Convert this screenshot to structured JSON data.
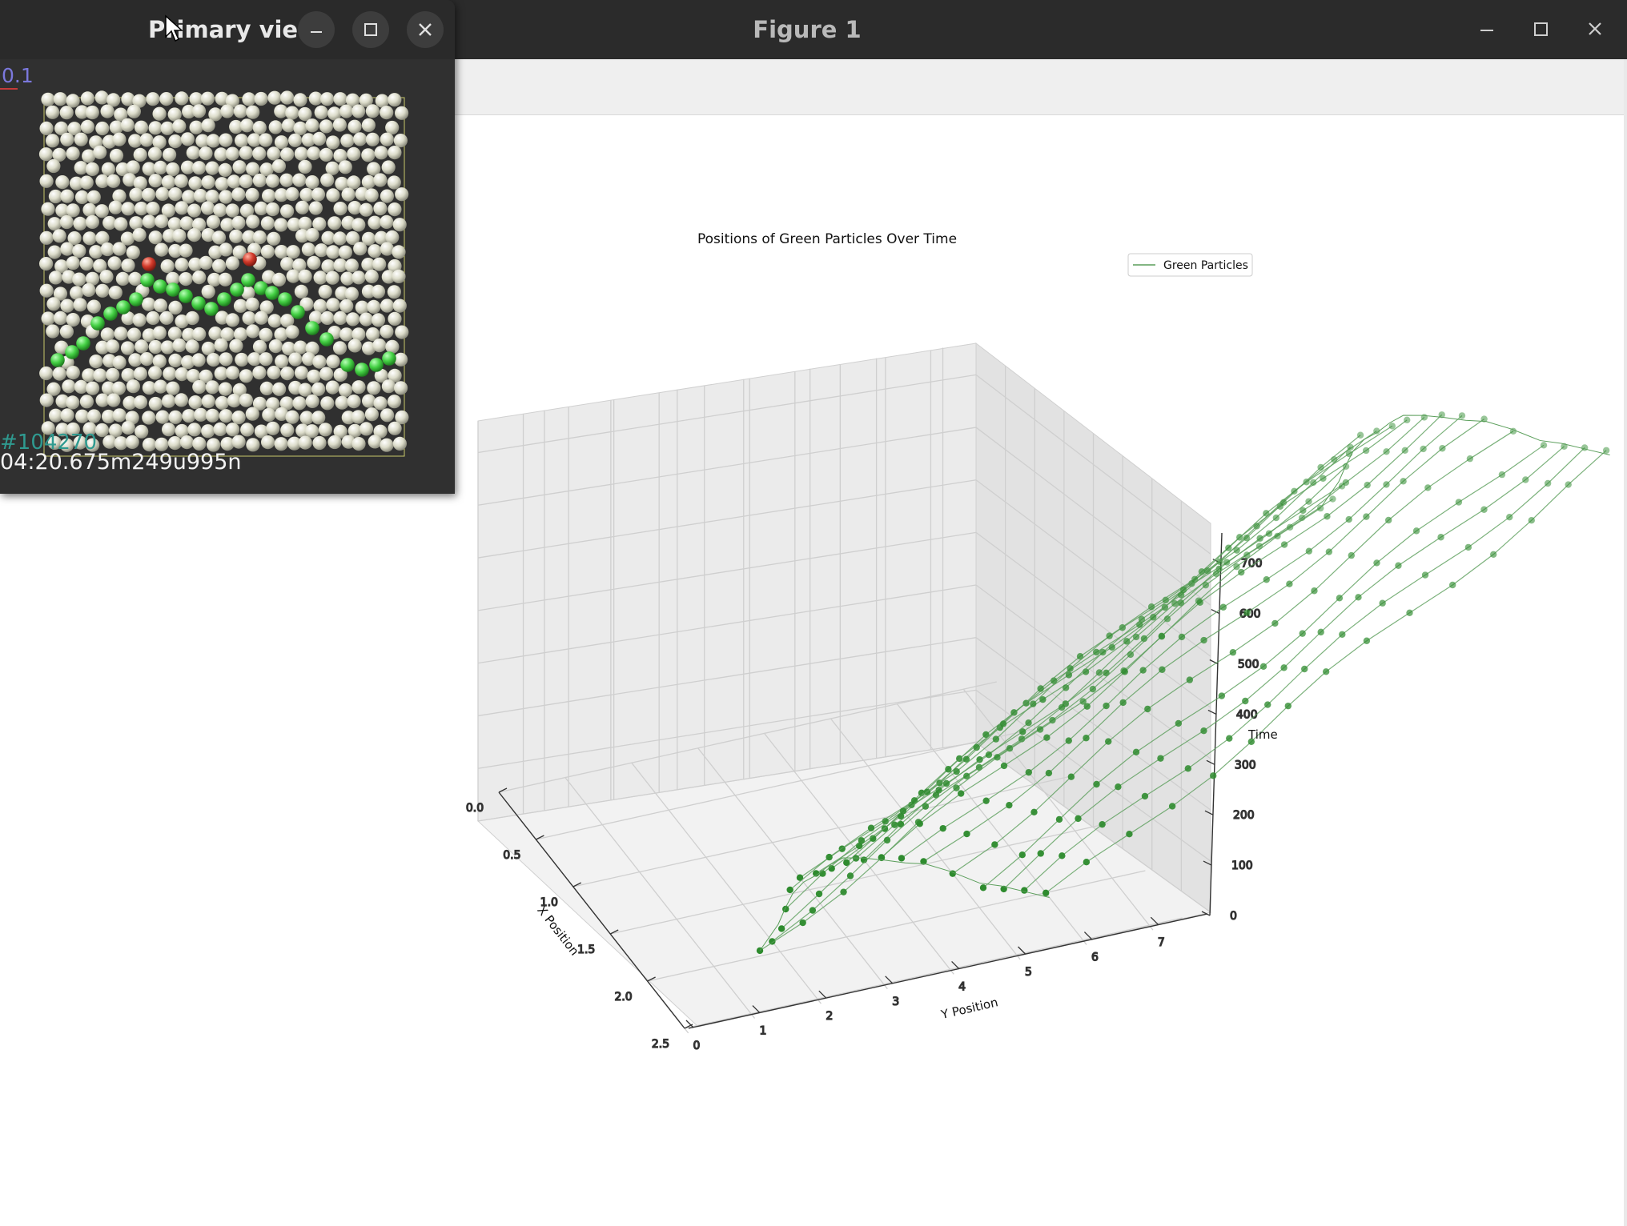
{
  "figure_window": {
    "title": "Figure 1",
    "controls": {
      "minimize": "minimize-icon",
      "maximize": "maximize-icon",
      "close": "close-icon"
    }
  },
  "primary_view": {
    "title": "Primary view",
    "scale_label": "0.1",
    "frame_label": "#104270",
    "time_label": "04:20.675m249u995n",
    "colors": {
      "particle": "#e9e9d2",
      "green": "#44d044",
      "red": "#d23a2a",
      "background": "#303030"
    }
  },
  "chart_data": {
    "type": "3d-line-scatter",
    "title": "Positions of Green Particles Over Time",
    "xlabel": "X Position",
    "ylabel": "Y Position",
    "zlabel": "Time",
    "xlim": [
      0.0,
      2.5
    ],
    "ylim": [
      0,
      7.5
    ],
    "zlim": [
      0,
      760
    ],
    "xticks": [
      "0.0",
      "0.5",
      "1.0",
      "1.5",
      "2.0",
      "2.5"
    ],
    "yticks": [
      "0",
      "1",
      "2",
      "3",
      "4",
      "5",
      "6",
      "7"
    ],
    "zticks": [
      "0",
      "100",
      "200",
      "300",
      "400",
      "500",
      "600",
      "700"
    ],
    "legend": {
      "label": "Green Particles",
      "placement": "upper-right"
    },
    "grid": true,
    "color": "#2e8b2e",
    "series": [
      {
        "name": "Green Particles",
        "y_positions": [
          1.75,
          2.0,
          2.25,
          2.5,
          2.75,
          3.0,
          3.25,
          3.5,
          3.75,
          4.0,
          4.25,
          4.5,
          4.75,
          5.0,
          5.25,
          5.5,
          5.75,
          6.0
        ],
        "time_steps": [
          0,
          50,
          100,
          150,
          200,
          250,
          300,
          350,
          400,
          450,
          500,
          550,
          600,
          650,
          700
        ],
        "x_profile": [
          1.95,
          1.85,
          1.75,
          1.62,
          1.5,
          1.42,
          1.38,
          1.32,
          1.28,
          1.32,
          1.38,
          1.45,
          1.5,
          1.62,
          1.78,
          1.85,
          1.95,
          2.05
        ]
      }
    ]
  }
}
